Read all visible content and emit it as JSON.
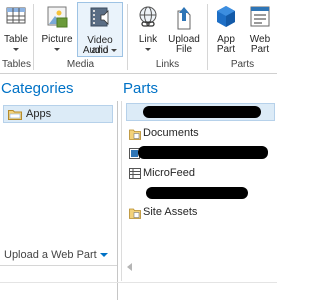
{
  "ribbon": {
    "buttons": [
      {
        "line1": "Table",
        "line2": "",
        "dropdown": true
      },
      {
        "line1": "Picture",
        "line2": "",
        "dropdown": true
      },
      {
        "line1": "Video and",
        "line2": "Audio",
        "dropdown": true
      },
      {
        "line1": "Link",
        "line2": "",
        "dropdown": true
      },
      {
        "line1": "Upload",
        "line2": "File",
        "dropdown": false
      },
      {
        "line1": "App",
        "line2": "Part",
        "dropdown": false
      },
      {
        "line1": "Web",
        "line2": "Part",
        "dropdown": false
      }
    ],
    "groups": [
      "Tables",
      "Media",
      "Links",
      "Parts"
    ]
  },
  "categories": {
    "header": "Categories",
    "items": [
      {
        "label": "Apps",
        "icon": "folder-icon"
      }
    ],
    "upload_label": "Upload a Web Part"
  },
  "parts": {
    "header": "Parts",
    "items": [
      {
        "label": "",
        "icon": "",
        "redacted": true
      },
      {
        "label": "Documents",
        "icon": "document-library-icon",
        "redacted": false
      },
      {
        "label": "",
        "icon": "image-icon",
        "redacted": true
      },
      {
        "label": "MicroFeed",
        "icon": "list-icon",
        "redacted": false
      },
      {
        "label": "",
        "icon": "",
        "redacted": true
      },
      {
        "label": "Site Assets",
        "icon": "document-library-icon",
        "redacted": false
      }
    ]
  },
  "colors": {
    "accent": "#0072c6",
    "selection": "#dcebf7",
    "selection_border": "#b6d1ea"
  }
}
